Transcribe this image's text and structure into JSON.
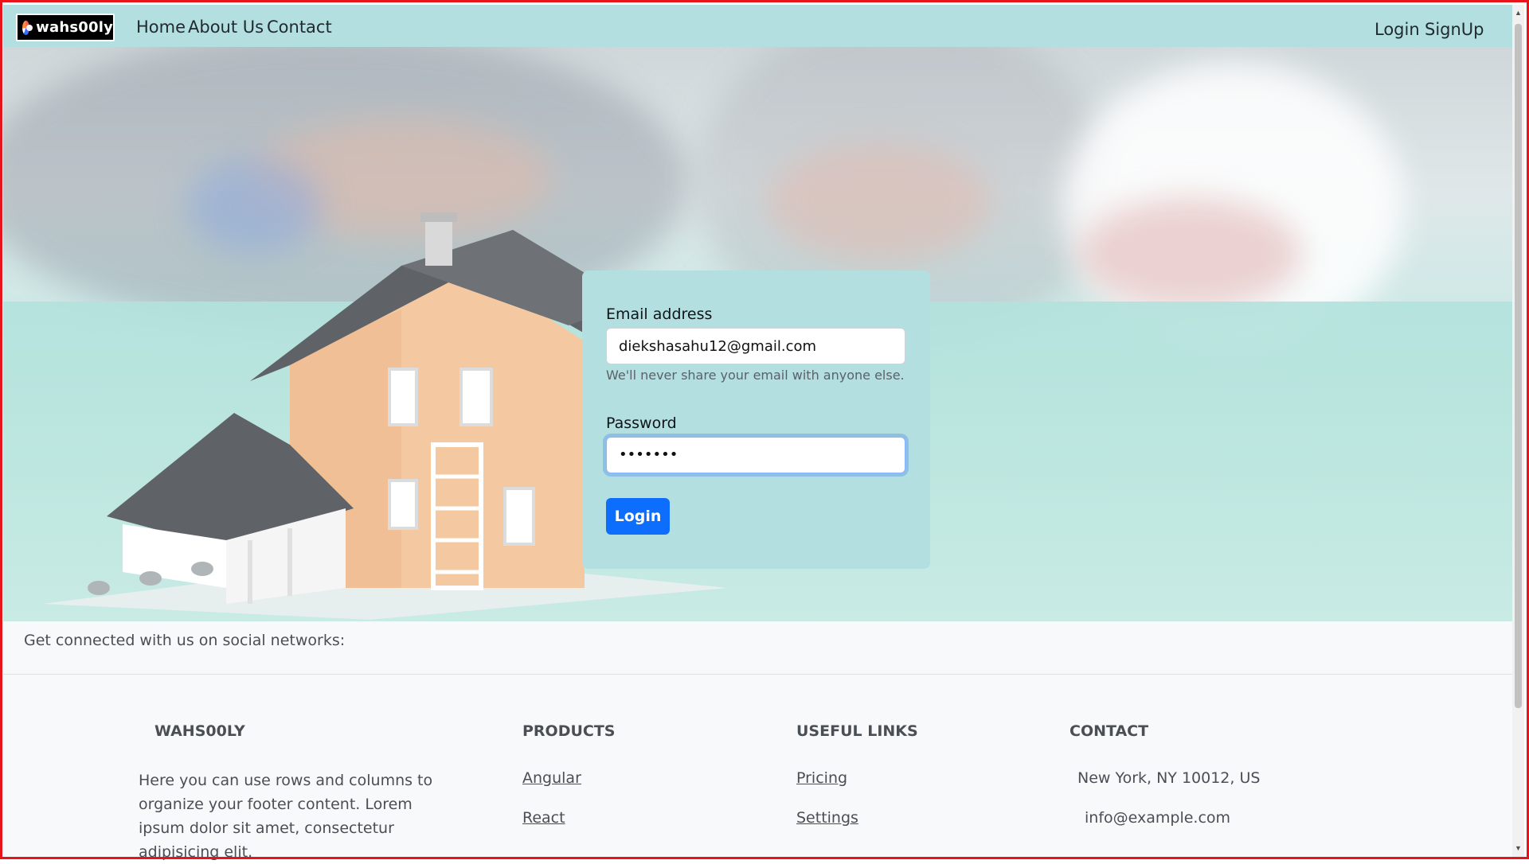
{
  "navbar": {
    "brand": "wahs00ly",
    "links": [
      {
        "label": "Home"
      },
      {
        "label": "About Us"
      },
      {
        "label": "Contact"
      }
    ],
    "auth": {
      "login": "Login",
      "signup": "SignUp"
    }
  },
  "login_form": {
    "email_label": "Email address",
    "email_value": "diekshasahu12@gmail.com",
    "email_help": "We'll never share your email with anyone else.",
    "password_label": "Password",
    "password_value": "•••••••",
    "submit_label": "Login",
    "submit_color": "#0d6efd"
  },
  "footer": {
    "social_text": "Get connected with us on social networks:",
    "brand_col": {
      "title": "WAHS00LY",
      "text": "Here you can use rows and columns to organize your footer content. Lorem ipsum dolor sit amet, consectetur adipisicing elit."
    },
    "products_col": {
      "title": "PRODUCTS",
      "links": [
        "Angular",
        "React"
      ]
    },
    "useful_col": {
      "title": "USEFUL LINKS",
      "links": [
        "Pricing",
        "Settings"
      ]
    },
    "contact_col": {
      "title": "CONTACT",
      "items": [
        "New York, NY 10012, US",
        "info@example.com"
      ]
    }
  },
  "colors": {
    "navbar_bg": "#b3dfe0",
    "card_bg": "#b3dfe0",
    "frame_border": "#e8141c"
  }
}
